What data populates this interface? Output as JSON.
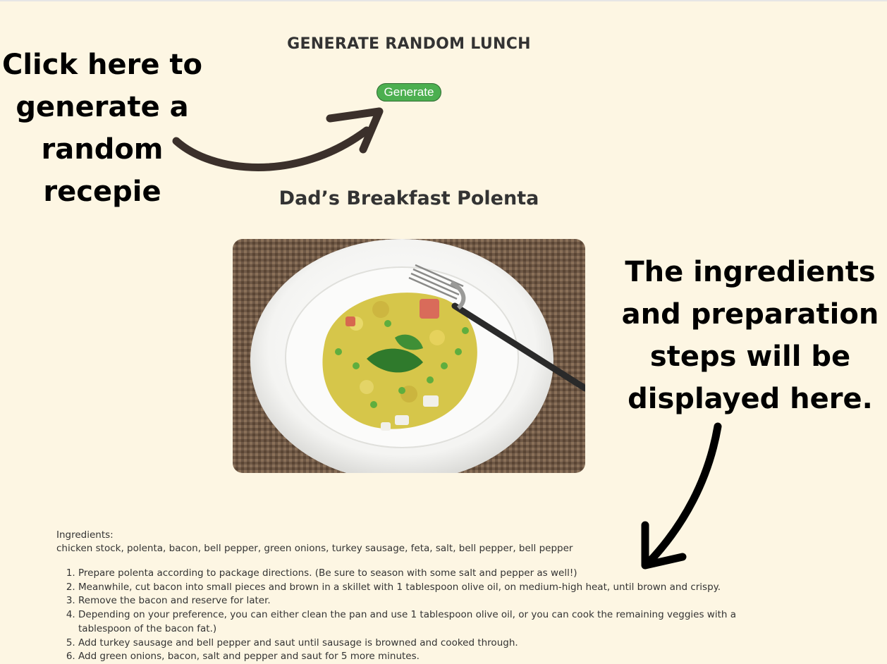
{
  "page": {
    "heading": "GENERATE RANDOM LUNCH",
    "generate_button": "Generate"
  },
  "recipe": {
    "title": "Dad’s Breakfast Polenta",
    "image_alt": "Breakfast polenta with sausage, bell pepper and herbs in a white bowl with a fork",
    "ingredients_label": "Ingredients:",
    "ingredients": "chicken stock, polenta, bacon, bell pepper, green onions, turkey sausage, feta, salt, bell pepper, bell pepper",
    "steps": [
      "Prepare polenta according to package directions. (Be sure to season with some salt and pepper as well!)",
      "Meanwhile, cut bacon into small pieces and brown in a skillet with 1 tablespoon olive oil, on medium-high heat, until brown and crispy.",
      "Remove the bacon and reserve for later.",
      "Depending on your preference, you can either clean the pan and use 1 tablespoon olive oil, or you can cook the remaining veggies with a tablespoon of the bacon fat.)",
      "Add turkey sausage and bell pepper and saut until sausage is browned and cooked through.",
      "Add green onions, bacon, salt and pepper and saut for 5 more minutes."
    ]
  },
  "annotations": {
    "left_callout": [
      "Click here to",
      "generate a",
      "random",
      "recepie"
    ],
    "right_callout": [
      "The ingredients",
      "and preparation",
      "steps will be",
      "displayed here."
    ]
  },
  "colors": {
    "background": "#fdf6e3",
    "button": "#4caf50",
    "text": "#333333",
    "arrow": "#3b302b"
  }
}
